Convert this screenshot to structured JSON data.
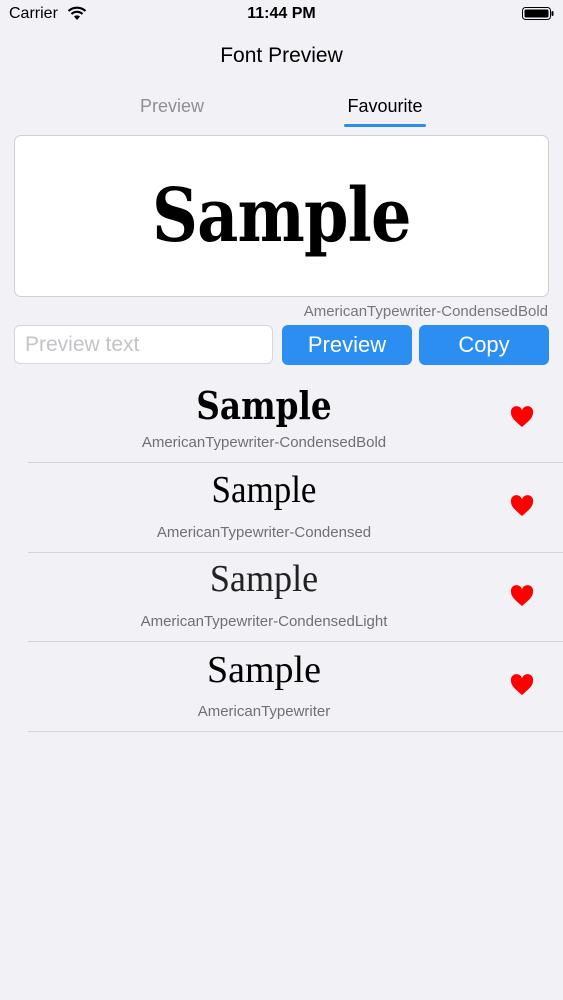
{
  "status_bar": {
    "carrier": "Carrier",
    "time": "11:44 PM"
  },
  "nav": {
    "title": "Font Preview"
  },
  "tabs": [
    {
      "label": "Preview",
      "active": false
    },
    {
      "label": "Favourite",
      "active": true
    }
  ],
  "preview": {
    "sample_text": "Sample",
    "font_name": "AmericanTypewriter-CondensedBold"
  },
  "controls": {
    "input_placeholder": "Preview text",
    "input_value": "",
    "preview_button": "Preview",
    "copy_button": "Copy"
  },
  "favourites": [
    {
      "sample": "Sample",
      "font_name": "AmericanTypewriter-CondensedBold",
      "favourite": true
    },
    {
      "sample": "Sample",
      "font_name": "AmericanTypewriter-Condensed",
      "favourite": true
    },
    {
      "sample": "Sample",
      "font_name": "AmericanTypewriter-CondensedLight",
      "favourite": true
    },
    {
      "sample": "Sample",
      "font_name": "AmericanTypewriter",
      "favourite": true
    }
  ],
  "colors": {
    "accent": "#2b8ef0",
    "heart": "#ff0000",
    "background": "#f2f1f6"
  }
}
